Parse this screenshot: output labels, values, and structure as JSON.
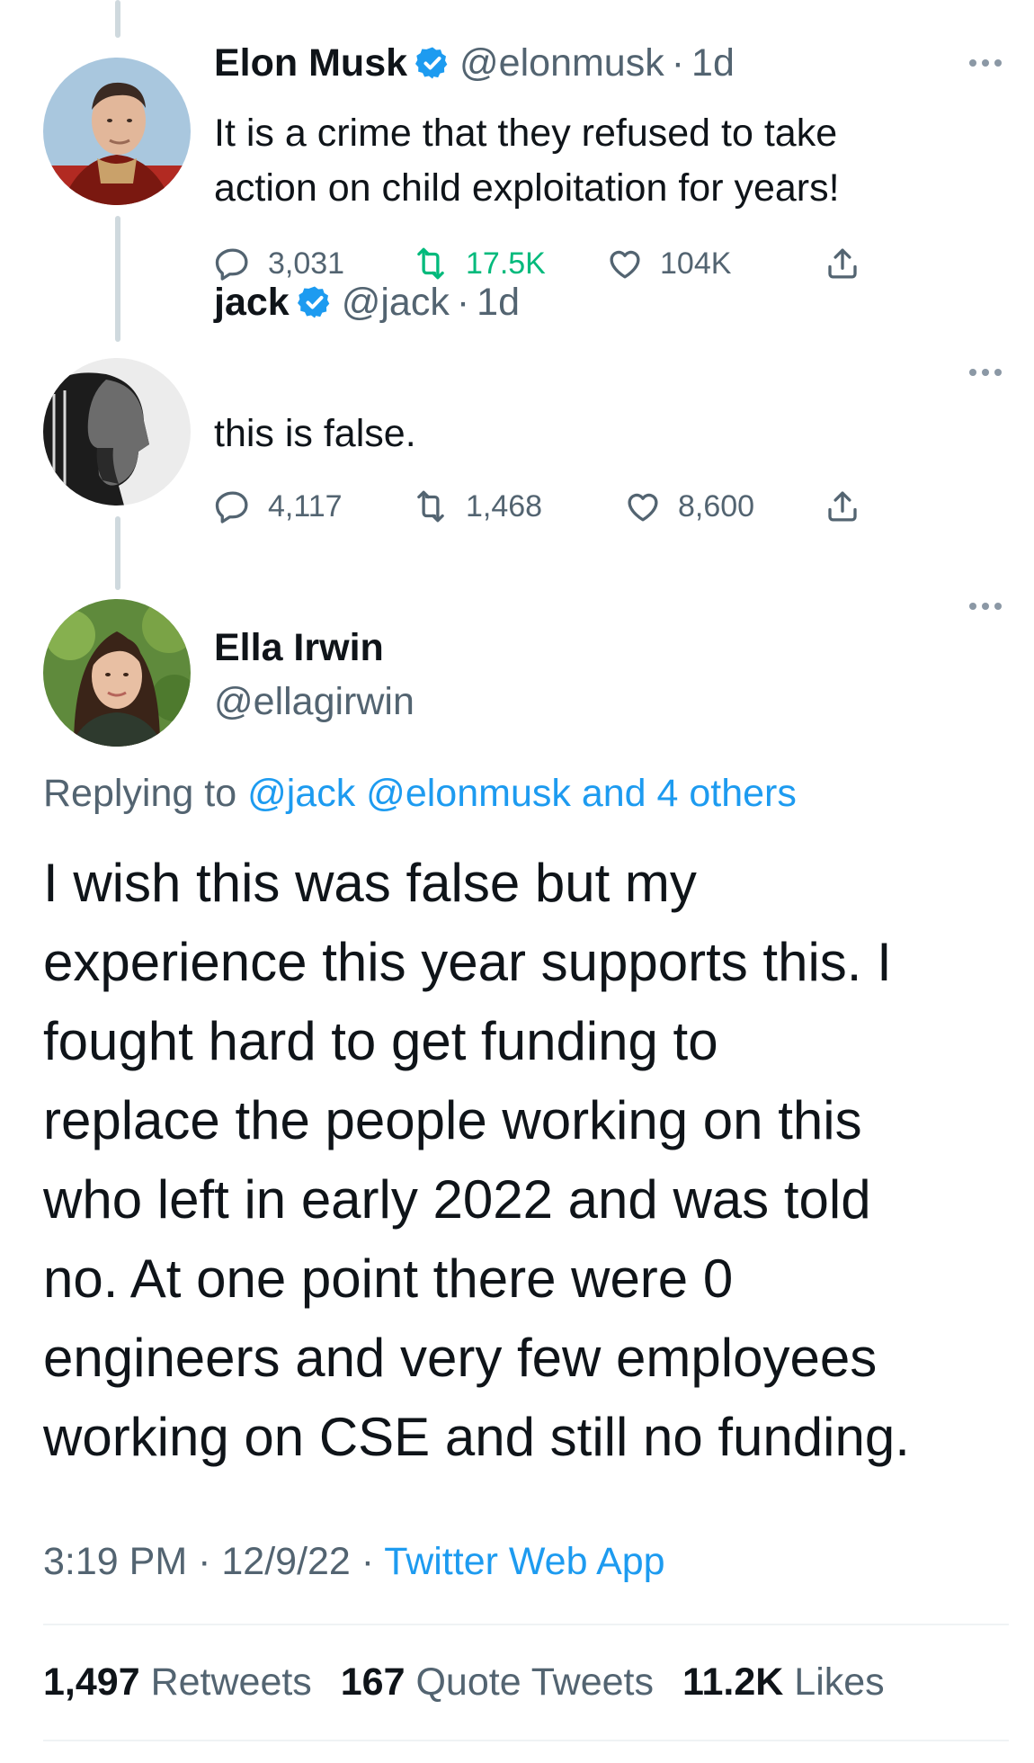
{
  "thread": [
    {
      "name": "Elon Musk",
      "handle": "@elonmusk",
      "separator": "·",
      "time": "1d",
      "text_lines": [
        "It is a crime that they refused to take",
        "action on child exploitation for years!"
      ],
      "replies": "3,031",
      "retweets": "17.5K",
      "retweeted": true,
      "likes": "104K"
    },
    {
      "name": "jack",
      "handle": "@jack",
      "separator": "·",
      "time": "1d",
      "text_lines": [
        "this is false."
      ],
      "replies": "4,117",
      "retweets": "1,468",
      "retweeted": false,
      "likes": "8,600"
    }
  ],
  "main_tweet": {
    "name": "Ella Irwin",
    "handle": "@ellagirwin",
    "replying_prefix": "Replying to",
    "replying_to": [
      "@jack",
      "@elonmusk"
    ],
    "replying_others": "and 4 others",
    "text_lines": [
      "I wish this was false but my",
      "experience this year supports this. I",
      "fought hard to get funding to",
      "replace the people working on this",
      "who left in early 2022 and was told",
      "no. At one point there were 0",
      "engineers and very few employees",
      "working on CSE and still no funding."
    ],
    "time": "3:19 PM",
    "date": "12/9/22",
    "separator": "·",
    "source": "Twitter Web App",
    "stats": {
      "retweets_count": "1,497",
      "retweets_label": "Retweets",
      "quotes_count": "167",
      "quotes_label": "Quote Tweets",
      "likes_count": "11.2K",
      "likes_label": "Likes"
    }
  },
  "colors": {
    "text": "#0f1419",
    "muted": "#536471",
    "link": "#1d9bf0",
    "verified": "#1d9bf0",
    "retweet_active": "#00ba7c",
    "thread_line": "#cfd9de"
  },
  "icons": {
    "reply": "reply-icon",
    "retweet": "retweet-icon",
    "like": "heart-icon",
    "share": "share-icon",
    "more": "more-icon",
    "verified": "verified-badge-icon"
  }
}
